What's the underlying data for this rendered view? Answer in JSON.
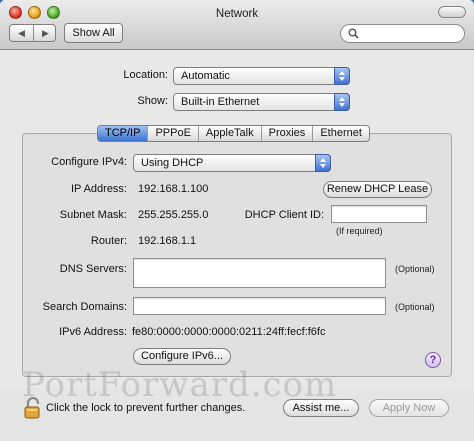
{
  "window": {
    "title": "Network"
  },
  "toolbar": {
    "show_all_label": "Show All",
    "back_icon": "back-arrow-icon",
    "forward_icon": "forward-arrow-icon",
    "search_placeholder": ""
  },
  "location": {
    "label": "Location:",
    "value": "Automatic"
  },
  "show": {
    "label": "Show:",
    "value": "Built-in Ethernet"
  },
  "tabs": [
    {
      "label": "TCP/IP",
      "active": true
    },
    {
      "label": "PPPoE",
      "active": false
    },
    {
      "label": "AppleTalk",
      "active": false
    },
    {
      "label": "Proxies",
      "active": false
    },
    {
      "label": "Ethernet",
      "active": false
    }
  ],
  "configure_ipv4": {
    "label": "Configure IPv4:",
    "value": "Using DHCP"
  },
  "ip_address": {
    "label": "IP Address:",
    "value": "192.168.1.100"
  },
  "renew_button": "Renew DHCP Lease",
  "subnet_mask": {
    "label": "Subnet Mask:",
    "value": "255.255.255.0"
  },
  "dhcp_client_id": {
    "label": "DHCP Client ID:",
    "value": "",
    "hint": "(If required)"
  },
  "router": {
    "label": "Router:",
    "value": "192.168.1.1"
  },
  "dns_servers": {
    "label": "DNS Servers:",
    "value": "",
    "hint": "(Optional)"
  },
  "search_domains": {
    "label": "Search Domains:",
    "value": "",
    "hint": "(Optional)"
  },
  "ipv6_address": {
    "label": "IPv6 Address:",
    "value": "fe80:0000:0000:0000:0211:24ff:fecf:f6fc"
  },
  "configure_ipv6_button": "Configure IPv6...",
  "help": "?",
  "lock_text": "Click the lock to prevent further changes.",
  "assist_button": "Assist me...",
  "apply_button": "Apply Now",
  "watermark": "PortForward.com",
  "colors": {
    "accent": "#3b73d2",
    "desktop": "#3d6fa8"
  }
}
